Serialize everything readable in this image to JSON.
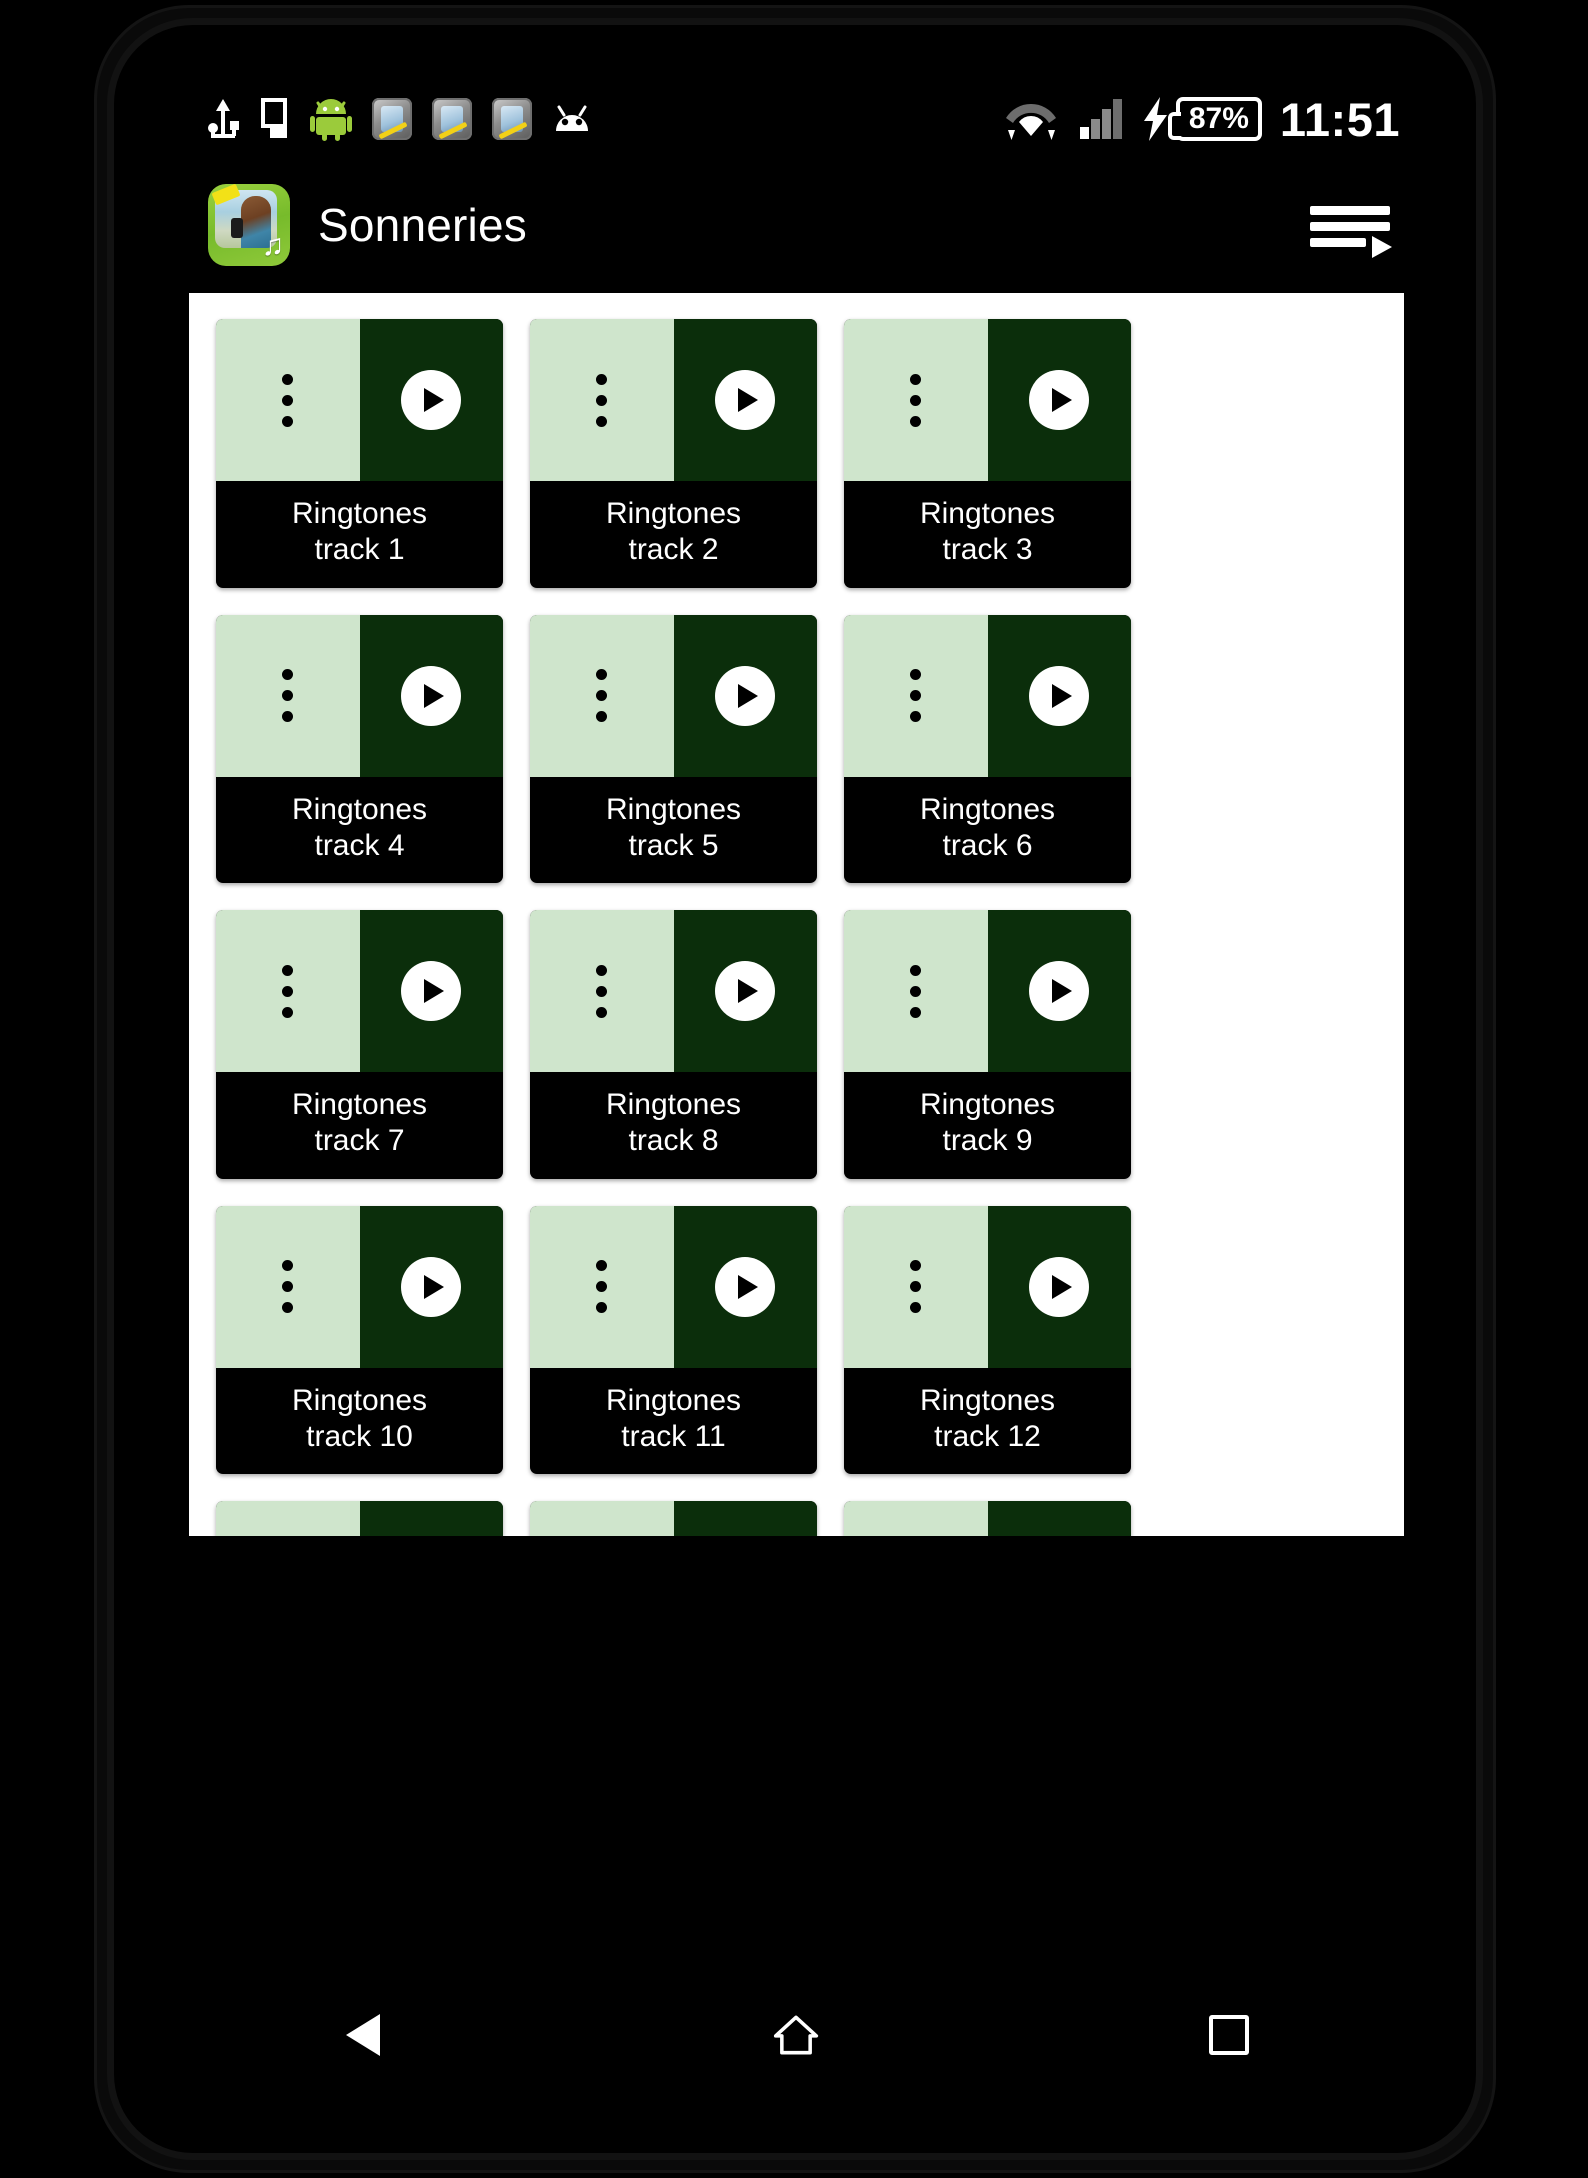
{
  "device": {
    "frame": "android-phone"
  },
  "status_bar": {
    "time": "11:51",
    "battery_percent": "87%",
    "charging": true,
    "left_icons": [
      "usb-icon",
      "sd-card-icon",
      "android-robot-icon",
      "screenshot-capture-icon",
      "screenshot-capture-icon",
      "screenshot-capture-icon",
      "android-head-icon"
    ],
    "right_icons": [
      "wifi-icon",
      "cellular-signal-icon",
      "charging-bolt-icon",
      "battery-icon"
    ]
  },
  "app_bar": {
    "title": "Sonneries",
    "icon_name": "app-icon-sonneries",
    "menu_icon": "playlist-menu-icon"
  },
  "colors": {
    "tile_light_green": "#cfe5cc",
    "tile_dark_green": "#0b2e0b",
    "tile_label_bg": "#000000",
    "card_bg": "#ffffff",
    "accent_green": "#8fc93a"
  },
  "grid": {
    "tiles": [
      {
        "label": "Ringtones\ntrack 1",
        "line1": "Ringtones",
        "line2": "track 1"
      },
      {
        "label": "Ringtones\ntrack 2",
        "line1": "Ringtones",
        "line2": "track 2"
      },
      {
        "label": "Ringtones\ntrack 3",
        "line1": "Ringtones",
        "line2": "track 3"
      },
      {
        "label": "Ringtones\ntrack 4",
        "line1": "Ringtones",
        "line2": "track 4"
      },
      {
        "label": "Ringtones\ntrack 5",
        "line1": "Ringtones",
        "line2": "track 5"
      },
      {
        "label": "Ringtones\ntrack 6",
        "line1": "Ringtones",
        "line2": "track 6"
      },
      {
        "label": "Ringtones\ntrack 7",
        "line1": "Ringtones",
        "line2": "track 7"
      },
      {
        "label": "Ringtones\ntrack 8",
        "line1": "Ringtones",
        "line2": "track 8"
      },
      {
        "label": "Ringtones\ntrack 9",
        "line1": "Ringtones",
        "line2": "track 9"
      },
      {
        "label": "Ringtones\ntrack 10",
        "line1": "Ringtones",
        "line2": "track 10"
      },
      {
        "label": "Ringtones\ntrack 11",
        "line1": "Ringtones",
        "line2": "track 11"
      },
      {
        "label": "Ringtones\ntrack 12",
        "line1": "Ringtones",
        "line2": "track 12"
      }
    ],
    "partial_row_count": 3,
    "tile_controls": {
      "menu_icon": "overflow-menu-dots-icon",
      "play_icon": "play-icon"
    }
  },
  "nav_bar": {
    "back_icon": "back-triangle-icon",
    "home_icon": "home-icon",
    "recents_icon": "recents-square-icon"
  }
}
